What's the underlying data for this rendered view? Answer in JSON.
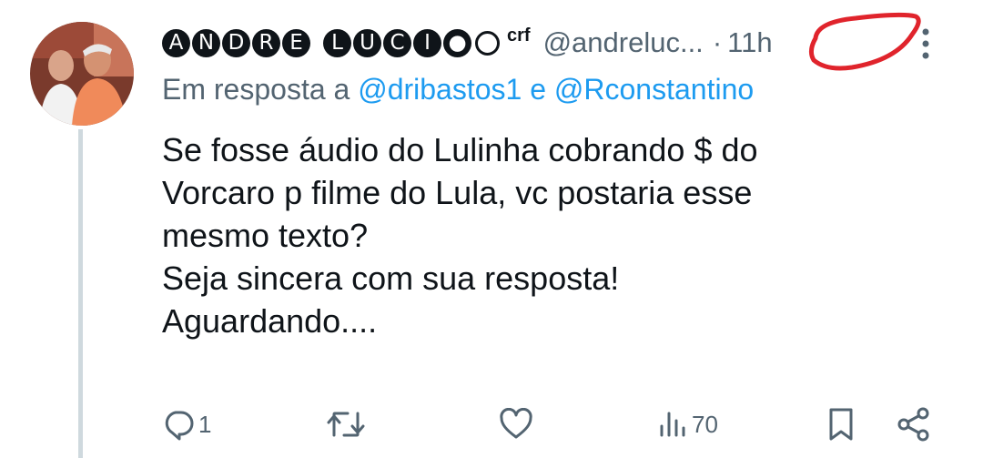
{
  "tweet": {
    "author": {
      "name_letters": [
        "A",
        "N",
        "D",
        "R",
        "E",
        "L",
        "U",
        "C",
        "I"
      ],
      "suffix": "crf",
      "handle": "@andreluc...",
      "time_sep": "·",
      "time": "11h"
    },
    "reply_to": {
      "prefix": "Em resposta a",
      "mention1": "@dribastos1",
      "joiner": "e",
      "mention2": "@Rconstantino"
    },
    "body_lines": [
      "Se fosse áudio do Lulinha cobrando $ do",
      "Vorcaro p filme do Lula, vc postaria esse",
      "mesmo texto?",
      "Seja sincera com sua resposta!",
      "Aguardando...."
    ],
    "stats": {
      "replies": "1",
      "reposts": "",
      "likes": "",
      "views": "70"
    }
  },
  "icons": {
    "reply": "reply-icon",
    "repost": "repost-icon",
    "like": "heart-icon",
    "views": "views-icon",
    "bookmark": "bookmark-icon",
    "share": "share-icon",
    "more": "more-icon"
  },
  "colors": {
    "text": "#0f1419",
    "muted": "#536471",
    "link": "#1d9bf0",
    "annotation": "#e0242c"
  }
}
